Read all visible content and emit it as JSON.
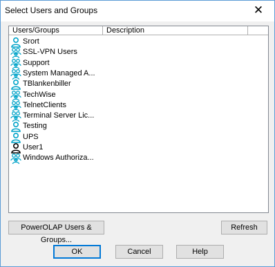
{
  "dialog": {
    "title": "Select Users and Groups",
    "close_glyph": "✕"
  },
  "list": {
    "columns": [
      "Users/Groups",
      "Description",
      ""
    ],
    "items": [
      {
        "label": "Srort",
        "icon": "user-icon",
        "color": "#00a3c8"
      },
      {
        "label": "SSL-VPN Users",
        "icon": "group-icon",
        "color": "#00a3c8"
      },
      {
        "label": "Support",
        "icon": "group-icon",
        "color": "#00a3c8"
      },
      {
        "label": "System Managed A...",
        "icon": "group-icon",
        "color": "#00a3c8"
      },
      {
        "label": "TBlankenbiller",
        "icon": "user-icon",
        "color": "#00a3c8"
      },
      {
        "label": "TechWise",
        "icon": "group-icon",
        "color": "#00a3c8"
      },
      {
        "label": "TelnetClients",
        "icon": "group-icon",
        "color": "#00a3c8"
      },
      {
        "label": "Terminal Server Lic...",
        "icon": "group-icon",
        "color": "#00a3c8"
      },
      {
        "label": "Testing",
        "icon": "user-icon",
        "color": "#00a3c8"
      },
      {
        "label": "UPS",
        "icon": "user-icon",
        "color": "#00a3c8"
      },
      {
        "label": "User1",
        "icon": "user-icon",
        "color": "#000000"
      },
      {
        "label": "Windows Authoriza...",
        "icon": "group-icon",
        "color": "#00a3c8"
      }
    ]
  },
  "buttons": {
    "powerolap": "PowerOLAP Users & Groups...",
    "refresh": "Refresh",
    "ok": "OK",
    "cancel": "Cancel",
    "help": "Help"
  }
}
